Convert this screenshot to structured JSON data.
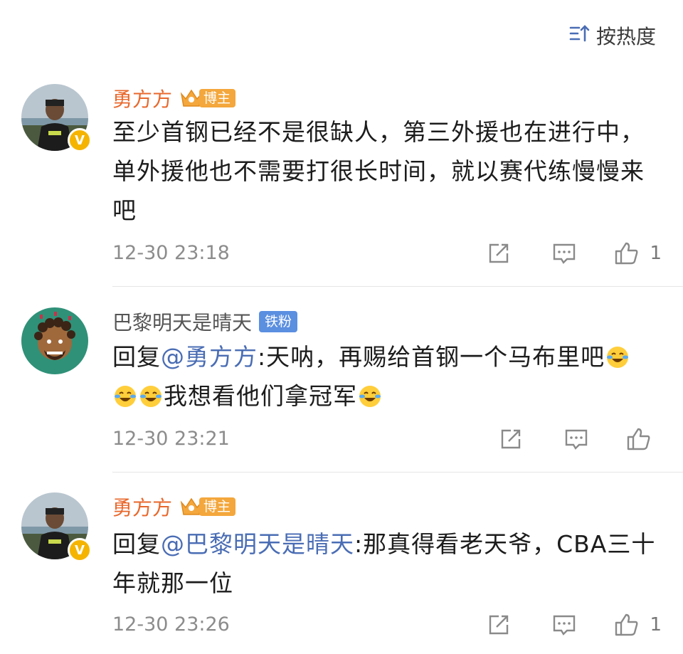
{
  "header": {
    "sort_label": "按热度",
    "sort_icon": "sort-icon"
  },
  "colors": {
    "vip_name": "#e8682c",
    "mention": "#4a6db4",
    "blogger_badge": "#f4a73c",
    "fan_badge": "#5b8fe0"
  },
  "comments": [
    {
      "username": "勇方方",
      "badge": "博主",
      "text": "至少首钢已经不是很缺人，第三外援也在进行中，单外援他也不需要打很长时间，就以赛代练慢慢来吧",
      "time": "12-30 23:18",
      "likes": "1"
    },
    {
      "username": "巴黎明天是晴天",
      "badge": "铁粉",
      "reply_prefix": "回复",
      "mention": "@勇方方",
      "text_a": ":天呐，再赐给首钢一个马布里吧",
      "text_b": "我想看他们拿冠军",
      "time": "12-30 23:21",
      "likes": ""
    },
    {
      "username": "勇方方",
      "badge": "博主",
      "reply_prefix": "回复",
      "mention": "@巴黎明天是晴天",
      "text": ":那真得看老天爷，CBA三十年就那一位",
      "time": "12-30 23:26",
      "likes": "1"
    }
  ]
}
